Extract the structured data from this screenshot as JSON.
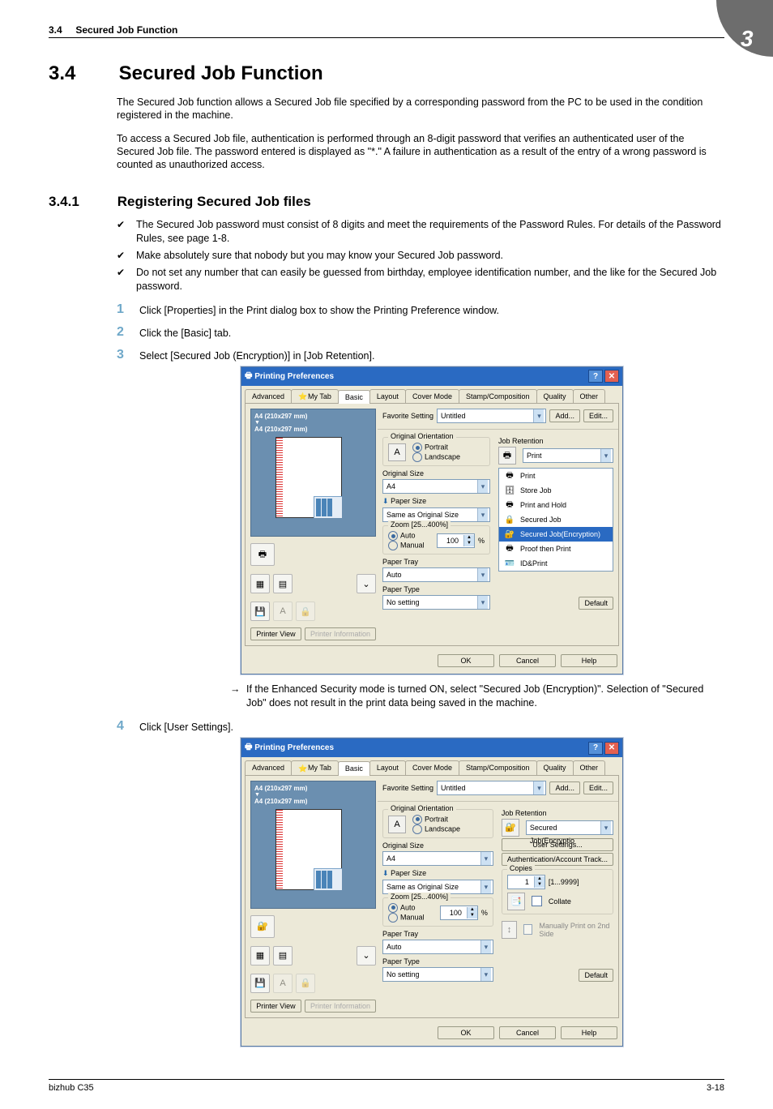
{
  "header": {
    "section_label": "3.4",
    "section_title_top": "Secured Job Function",
    "chapter_badge": "3"
  },
  "h1": {
    "num": "3.4",
    "title": "Secured Job Function"
  },
  "para1": "The Secured Job function allows a Secured Job file specified by a corresponding password from the PC to be used in the condition registered in the machine.",
  "para2": "To access a Secured Job file, authentication is performed through an 8-digit password that verifies an authenticated user of the Secured Job file. The password entered is displayed as \"*.\" A failure in authentication as a result of the entry of a wrong password is counted as unauthorized access.",
  "h2": {
    "num": "3.4.1",
    "title": "Registering Secured Job files"
  },
  "bullets": [
    "The Secured Job password must consist of 8 digits and meet the requirements of the Password Rules. For details of the Password Rules, see page 1-8.",
    "Make absolutely sure that nobody but you may know your Secured Job password.",
    "Do not set any number that can easily be guessed from birthday, employee identification number, and the like for the Secured Job password."
  ],
  "steps": {
    "s1": "Click [Properties] in the Print dialog box to show the Printing Preference window.",
    "s2": "Click the [Basic] tab.",
    "s3": "Select [Secured Job (Encryption)] in [Job Retention].",
    "s3_note": "If the Enhanced Security mode is turned ON, select \"Secured Job (Encryption)\". Selection of \"Secured Job\" does not result in the print data being saved in the machine.",
    "s4": "Click [User Settings]."
  },
  "dialog": {
    "title": "Printing Preferences",
    "tabs": [
      "Advanced",
      "My Tab",
      "Basic",
      "Layout",
      "Cover Mode",
      "Stamp/Composition",
      "Quality",
      "Other"
    ],
    "active_tab": "Basic",
    "favorite_label": "Favorite Setting",
    "favorite_value": "Untitled",
    "add_btn": "Add...",
    "edit_btn": "Edit...",
    "preview_dims": "A4 (210x297 mm)",
    "preview_dims2": "A4 (210x297 mm)",
    "printer_view_btn": "Printer View",
    "printer_info_btn": "Printer Information",
    "orientation": {
      "title": "Original Orientation",
      "portrait": "Portrait",
      "landscape": "Landscape"
    },
    "original_size_label": "Original Size",
    "original_size_value": "A4",
    "paper_size_label": "Paper Size",
    "paper_size_value": "Same as Original Size",
    "zoom": {
      "title": "Zoom [25...400%]",
      "auto": "Auto",
      "manual": "Manual",
      "value": "100",
      "unit": "%"
    },
    "paper_tray_label": "Paper Tray",
    "paper_tray_value": "Auto",
    "paper_type_label": "Paper Type",
    "paper_type_value": "No setting",
    "job_retention_label": "Job Retention",
    "job_retention_top_value": "Print",
    "job_retention_options": [
      "Print",
      "Store Job",
      "Print and Hold",
      "Secured Job",
      "Secured Job(Encryption)",
      "Proof then Print",
      "ID&Print"
    ],
    "default_btn": "Default",
    "ok_btn": "OK",
    "cancel_btn": "Cancel",
    "help_btn": "Help"
  },
  "dialog2": {
    "job_retention_value": "Secured Job(Encryptio",
    "user_settings_btn": "User Settings...",
    "auth_btn": "Authentication/Account Track...",
    "copies_title": "Copies",
    "copies_value": "1",
    "copies_range": "[1...9999]",
    "collate_label": "Collate",
    "manual_2nd_side": "Manually Print on 2nd Side"
  },
  "footer": {
    "left": "bizhub C35",
    "right": "3-18"
  }
}
